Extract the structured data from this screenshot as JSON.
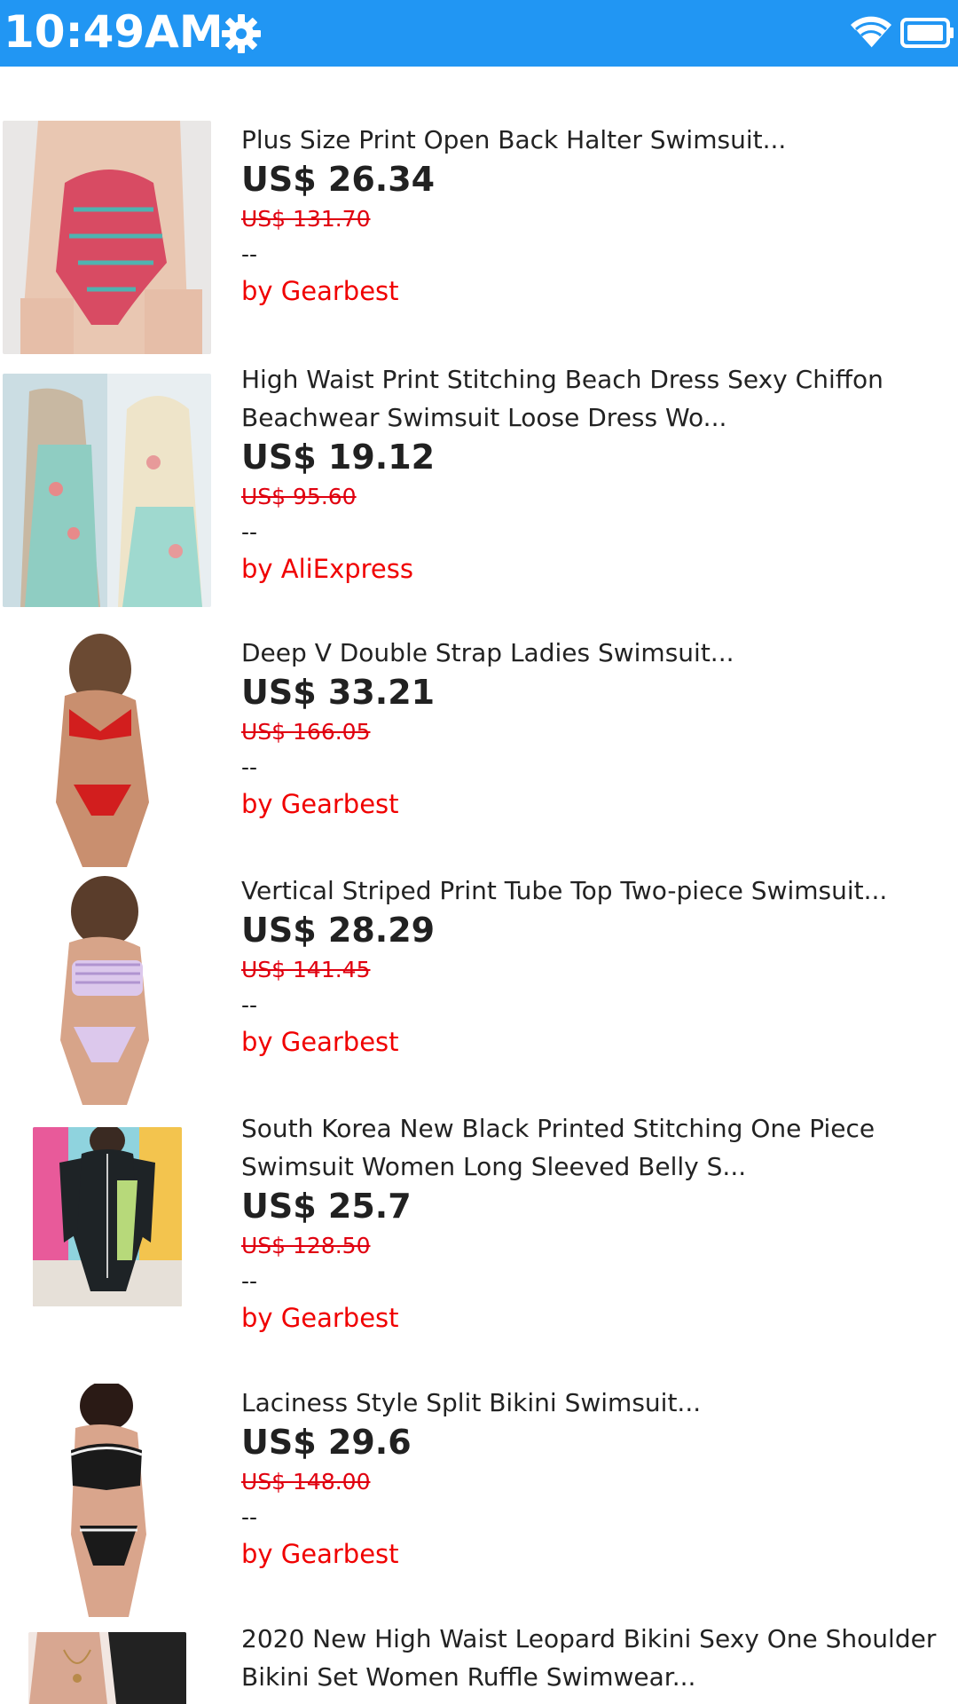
{
  "status_bar": {
    "time": "10:49AM",
    "background": "#2196f3",
    "icons": [
      "gear-icon",
      "wifi-icon",
      "battery-icon"
    ]
  },
  "products": [
    {
      "title": "Plus Size Print Open Back Halter Swimsuit...",
      "price": "US$ 26.34",
      "original_price": "US$ 131.70",
      "rating": "--",
      "seller": "by Gearbest"
    },
    {
      "title": "High Waist Print Stitching Beach Dress Sexy Chiffon Beachwear Swimsuit Loose Dress Wo...",
      "price": "US$ 19.12",
      "original_price": "US$ 95.60",
      "rating": "--",
      "seller": "by AliExpress"
    },
    {
      "title": "Deep V Double Strap Ladies Swimsuit...",
      "price": "US$ 33.21",
      "original_price": "US$ 166.05",
      "rating": "--",
      "seller": "by Gearbest"
    },
    {
      "title": "Vertical Striped Print Tube Top Two-piece Swimsuit...",
      "price": "US$ 28.29",
      "original_price": "US$ 141.45",
      "rating": "--",
      "seller": "by Gearbest"
    },
    {
      "title": "South Korea New Black Printed Stitching One Piece Swimsuit Women Long Sleeved Belly S...",
      "price": "US$ 25.7",
      "original_price": "US$ 128.50",
      "rating": "--",
      "seller": "by Gearbest"
    },
    {
      "title": "Laciness Style Split Bikini Swimsuit...",
      "price": "US$ 29.6",
      "original_price": "US$ 148.00",
      "rating": "--",
      "seller": "by Gearbest"
    },
    {
      "title": "2020 New High Waist Leopard Bikini Sexy One Shoulder Bikini Set Women Ruffle Swimwear...",
      "price": "",
      "original_price": "",
      "rating": "",
      "seller": ""
    }
  ],
  "colors": {
    "price": "#212121",
    "original_price": "#e0000f",
    "seller": "#f00000"
  }
}
